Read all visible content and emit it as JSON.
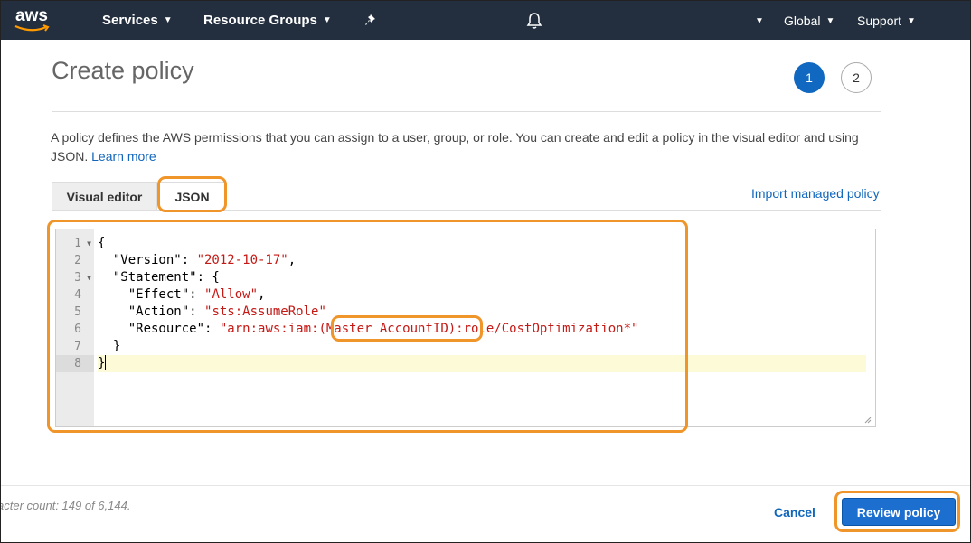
{
  "nav": {
    "logo_text": "aws",
    "services": "Services",
    "resource_groups": "Resource Groups",
    "account_caret": "▾",
    "region": "Global",
    "support": "Support"
  },
  "page": {
    "title": "Create policy",
    "steps": [
      "1",
      "2"
    ],
    "description": "A policy defines the AWS permissions that you can assign to a user, group, or role. You can create and edit a policy in the visual editor and using JSON.",
    "learn_more": "Learn more"
  },
  "tabs": {
    "visual_editor": "Visual editor",
    "json": "JSON",
    "import_link": "Import managed policy"
  },
  "editor": {
    "line_numbers": [
      "1",
      "2",
      "3",
      "4",
      "5",
      "6",
      "7",
      "8"
    ],
    "lines": {
      "l1": "{",
      "l2_key": "\"Version\"",
      "l2_val": "\"2012-10-17\"",
      "l3_key": "\"Statement\"",
      "l4_key": "\"Effect\"",
      "l4_val": "\"Allow\"",
      "l5_key": "\"Action\"",
      "l5_val": "\"sts:AssumeRole\"",
      "l6_key": "\"Resource\"",
      "l6_val_a": "\"arn:aws:iam:",
      "l6_val_b": "(Master AccountID)",
      "l6_val_c": ":role/CostOptimization*\"",
      "l7": "}",
      "l8": "}"
    }
  },
  "footer": {
    "char_count": "acter count: 149 of 6,144.",
    "cancel": "Cancel",
    "review": "Review policy"
  },
  "colors": {
    "nav_bg": "#232f3e",
    "primary": "#1d6fcf",
    "link": "#1166bb",
    "highlight": "#f0952a",
    "string": "#c41a16"
  }
}
